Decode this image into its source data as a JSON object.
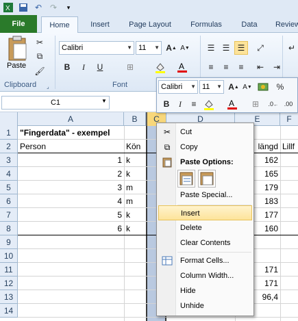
{
  "qat": {
    "icons": [
      "excel-icon",
      "save-icon",
      "undo-icon",
      "redo-icon",
      "customize-icon"
    ]
  },
  "tabs": [
    "File",
    "Home",
    "Insert",
    "Page Layout",
    "Formulas",
    "Data",
    "Review"
  ],
  "ribbon": {
    "paste_label": "Paste",
    "font_name": "Calibri",
    "font_size": "11",
    "group_clipboard": "Clipboard",
    "group_font": "Font"
  },
  "name_box": "C1",
  "columns": [
    "A",
    "B",
    "C",
    "D",
    "E",
    "F"
  ],
  "rows": [
    "1",
    "2",
    "3",
    "4",
    "5",
    "6",
    "7",
    "8",
    "9",
    "10",
    "11",
    "12",
    "13",
    "14"
  ],
  "cells": {
    "a1": "\"Fingerdata\" - exempel",
    "a2": "Person",
    "b2": "Kön",
    "e2": "längd",
    "f2": "Lillf",
    "a3": "1",
    "b3": "k",
    "e3": "162",
    "a4": "2",
    "b4": "k",
    "e4": "165",
    "a5": "3",
    "b5": "m",
    "e5": "179",
    "a6": "4",
    "b6": "m",
    "e6": "183",
    "a7": "5",
    "b7": "k",
    "e7": "177",
    "a8": "6",
    "b8": "k",
    "e8": "160",
    "e11": "171",
    "e12": "171",
    "e13": "96,4"
  },
  "mini_toolbar": {
    "font_name": "Calibri",
    "font_size": "11",
    "percent": "%"
  },
  "context_menu": {
    "cut": "Cut",
    "copy": "Copy",
    "paste_options": "Paste Options:",
    "paste_special": "Paste Special...",
    "insert": "Insert",
    "delete": "Delete",
    "clear_contents": "Clear Contents",
    "format_cells": "Format Cells...",
    "column_width": "Column Width...",
    "hide": "Hide",
    "unhide": "Unhide"
  },
  "colors": {
    "file_tab": "#2a7a2a",
    "highlight": "#fde39a",
    "selection": "#b9c9e0",
    "header_bg": "#e4ecf7"
  }
}
